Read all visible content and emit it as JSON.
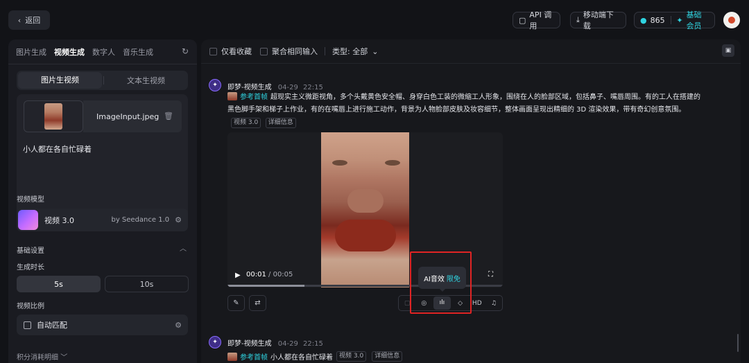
{
  "topbar": {
    "back_label": "返回",
    "api_label": "API 调用",
    "mobile_label": "移动端下载",
    "credits": "865",
    "member_label": "基础会员"
  },
  "left_panel": {
    "tabs": [
      "图片生成",
      "视频生成",
      "数字人",
      "音乐生成"
    ],
    "active_tab": "视频生成",
    "mode_options": [
      "图片生视频",
      "文本生视频"
    ],
    "active_mode": "图片生视频",
    "file_name": "ImageInput.jpeg",
    "prompt": "小人都在各自忙碌着",
    "model_section_label": "视频模型",
    "model_name": "视频 3.0",
    "model_by": "by Seedance 1.0",
    "basic_settings_label": "基础设置",
    "duration_label": "生成时长",
    "duration_options": [
      "5s",
      "10s"
    ],
    "selected_duration": "5s",
    "ratio_label": "视频比例",
    "ratio_value": "自动匹配",
    "cost_label": "积分消耗明细"
  },
  "main": {
    "filters": {
      "favorites_only": "仅看收藏",
      "aggregate_same_input": "聚合相同输入",
      "type_label": "类型: 全部"
    },
    "generations": [
      {
        "title": "即梦-视频生成",
        "date": "04-29",
        "time": "22:15",
        "ref_label": "参考首帧",
        "description": "超现实主义微距视角，多个头戴黄色安全帽、身穿白色工装的微缩工人形象，围绕在人的脸部区域，包括鼻子、嘴唇周围。有的工人在搭建的黑色脚手架和梯子上作业，有的在嘴唇上进行施工动作，背景为人物脸部皮肤及妆容细节，整体画面呈现出精细的 3D 渲染效果，带有奇幻创意氛围。",
        "chips": [
          "视频 3.0",
          "详细信息"
        ],
        "player": {
          "current_time": "00:01",
          "duration": "00:05",
          "progress_fraction": 0.28
        },
        "toolstrip": [
          "HD"
        ],
        "tooltip_label": "AI音效",
        "tooltip_free": "限免"
      },
      {
        "title": "即梦-视频生成",
        "date": "04-29",
        "time": "22:15",
        "ref_label": "参考首帧",
        "description": "小人都在各自忙碌着",
        "chips": [
          "视频 3.0",
          "详细信息"
        ]
      }
    ]
  },
  "colors": {
    "accent": "#2fd3e0",
    "highlight_box": "#e02424",
    "background": "#121317"
  }
}
